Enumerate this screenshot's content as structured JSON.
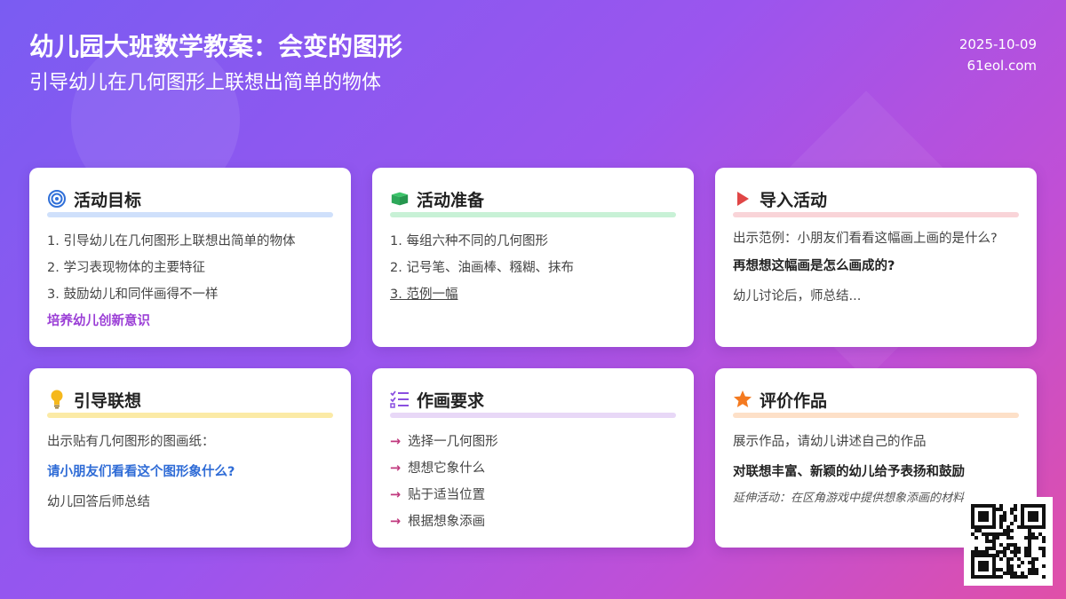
{
  "header": {
    "title": "幼儿园大班数学教案：会变的图形",
    "subtitle": "引导幼儿在几何图形上联想出简单的物体",
    "date": "2025-10-09",
    "site": "61eol.com"
  },
  "colors": {
    "goal": "#cfe0fb",
    "prep": "#c8f1d6",
    "intro": "#f9d4d8",
    "assoc": "#fbeaa6",
    "req": "#e8d8f7",
    "eval": "#fde0c8"
  },
  "cards": {
    "goal": {
      "icon": "target-icon",
      "title": "活动目标",
      "lines": [
        "1. 引导幼儿在几何图形上联想出简单的物体",
        "2. 学习表现物体的主要特征",
        "3. 鼓励幼儿和同伴画得不一样"
      ],
      "highlight": "培养幼儿创新意识"
    },
    "prep": {
      "icon": "box-icon",
      "title": "活动准备",
      "lines": [
        "1. 每组六种不同的几何图形",
        "2. 记号笔、油画棒、糨糊、抹布",
        "3. 范例一幅"
      ]
    },
    "intro": {
      "icon": "play-icon",
      "title": "导入活动",
      "line1": "出示范例：小朋友们看看这幅画上画的是什么?",
      "line2": "再想想这幅画是怎么画成的?",
      "line3": "幼儿讨论后，师总结..."
    },
    "assoc": {
      "icon": "lightbulb-icon",
      "title": "引导联想",
      "line1": "出示贴有几何图形的图画纸：",
      "line2": "请小朋友们看看这个图形象什么?",
      "line3": "幼儿回答后师总结"
    },
    "req": {
      "icon": "checklist-icon",
      "title": "作画要求",
      "items": [
        "选择一几何图形",
        "想想它象什么",
        "贴于适当位置",
        "根据想象添画"
      ]
    },
    "eval": {
      "icon": "star-icon",
      "title": "评价作品",
      "line1": "展示作品，请幼儿讲述自己的作品",
      "line2": "对联想丰富、新颖的幼儿给予表扬和鼓励",
      "line3": "延伸活动：在区角游戏中提供想象添画的材料"
    }
  }
}
